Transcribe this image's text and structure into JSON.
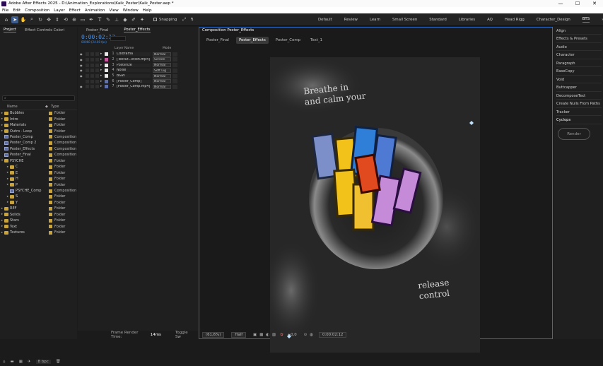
{
  "window": {
    "title": "Adobe After Effects 2025 - D:\\Animation_Explorations\\Kaik_Poster\\Kaik_Poster.aep *",
    "controls": [
      "—",
      "☐",
      "✕"
    ]
  },
  "menu": [
    "File",
    "Edit",
    "Composition",
    "Layer",
    "Effect",
    "Animation",
    "View",
    "Window",
    "Help"
  ],
  "toolbar": {
    "snapping_label": "Snapping"
  },
  "workspaces": [
    "Default",
    "Review",
    "Learn",
    "Small Screen",
    "Standard",
    "Libraries",
    "AQ",
    "Head Rigg",
    "Character_Design",
    "BTS"
  ],
  "active_workspace": "BTS",
  "project_panel": {
    "tabs": [
      "Project",
      "Effect Controls Colori"
    ],
    "search_placeholder": "",
    "columns": {
      "name": "Name",
      "type": "Type"
    },
    "items": [
      {
        "name": "Bubbles",
        "type": "Folder",
        "kind": "folder",
        "indent": 0,
        "expanded": false,
        "label_color": "#c9a43d"
      },
      {
        "name": "Intro",
        "type": "Folder",
        "kind": "folder",
        "indent": 0,
        "expanded": false,
        "label_color": "#c9a43d"
      },
      {
        "name": "Materials",
        "type": "Folder",
        "kind": "folder",
        "indent": 0,
        "expanded": false,
        "label_color": "#c9a43d"
      },
      {
        "name": "Outro - Loop",
        "type": "Folder",
        "kind": "folder",
        "indent": 0,
        "expanded": false,
        "label_color": "#c9a43d"
      },
      {
        "name": "Poster_Comp",
        "type": "Composition",
        "kind": "comp",
        "indent": 0,
        "expanded": false,
        "label_color": "#c9a43d"
      },
      {
        "name": "Poster_Comp 2",
        "type": "Composition",
        "kind": "comp",
        "indent": 0,
        "expanded": false,
        "label_color": "#c9a43d"
      },
      {
        "name": "Poster_Effects",
        "type": "Composition",
        "kind": "comp",
        "indent": 0,
        "expanded": false,
        "label_color": "#c9a43d"
      },
      {
        "name": "Poster_Final",
        "type": "Composition",
        "kind": "comp",
        "indent": 0,
        "expanded": false,
        "label_color": "#c9a43d"
      },
      {
        "name": "PSYCHE",
        "type": "Folder",
        "kind": "folder",
        "indent": 0,
        "expanded": true,
        "label_color": "#c9a43d"
      },
      {
        "name": "C",
        "type": "Folder",
        "kind": "folder",
        "indent": 1,
        "expanded": false,
        "label_color": "#c9a43d"
      },
      {
        "name": "E",
        "type": "Folder",
        "kind": "folder",
        "indent": 1,
        "expanded": false,
        "label_color": "#c9a43d"
      },
      {
        "name": "H",
        "type": "Folder",
        "kind": "folder",
        "indent": 1,
        "expanded": false,
        "label_color": "#c9a43d"
      },
      {
        "name": "P",
        "type": "Folder",
        "kind": "folder",
        "indent": 1,
        "expanded": false,
        "label_color": "#c9a43d"
      },
      {
        "name": "PSYCHE_Comp",
        "type": "Composition",
        "kind": "comp",
        "indent": 1,
        "expanded": false,
        "label_color": "#c9a43d"
      },
      {
        "name": "S",
        "type": "Folder",
        "kind": "folder",
        "indent": 1,
        "expanded": false,
        "label_color": "#c9a43d"
      },
      {
        "name": "Y",
        "type": "Folder",
        "kind": "folder",
        "indent": 1,
        "expanded": false,
        "label_color": "#c9a43d"
      },
      {
        "name": "REF",
        "type": "Folder",
        "kind": "folder",
        "indent": 0,
        "expanded": false,
        "label_color": "#c9a43d"
      },
      {
        "name": "Solids",
        "type": "Folder",
        "kind": "folder",
        "indent": 0,
        "expanded": false,
        "label_color": "#c9a43d"
      },
      {
        "name": "Stars",
        "type": "Folder",
        "kind": "folder",
        "indent": 0,
        "expanded": false,
        "label_color": "#c9a43d"
      },
      {
        "name": "Text",
        "type": "Folder",
        "kind": "folder",
        "indent": 0,
        "expanded": false,
        "label_color": "#c9a43d"
      },
      {
        "name": "Textures",
        "type": "Folder",
        "kind": "folder",
        "indent": 0,
        "expanded": false,
        "label_color": "#c9a43d"
      }
    ],
    "bpc": "8 bpc"
  },
  "timeline": {
    "tabs": [
      "Poster_Final",
      "Poster_Effects"
    ],
    "active_tab": "Poster_Effects",
    "timecode": "0:00:02:12",
    "timecode_sub": "00060 (24.00 fps)",
    "col_layer_name": "Layer Name",
    "col_mode": "Mode",
    "layers": [
      {
        "num": "1",
        "name": "Colorama",
        "mode": "Normal",
        "color": "#e8e8e8"
      },
      {
        "name": "[Textur...otion.mp4]",
        "num": "2",
        "mode": "Screen",
        "color": "#c45a9c"
      },
      {
        "num": "3",
        "name": "Posterize",
        "mode": "Normal",
        "color": "#e8e8e8"
      },
      {
        "num": "4",
        "name": "Noise",
        "mode": "Soft Lig",
        "color": "#e8e8e8"
      },
      {
        "num": "5",
        "name": "B&W",
        "mode": "Normal",
        "color": "#e8e8e8"
      },
      {
        "num": "6",
        "name": "[Poster_Comp]",
        "mode": "Normal",
        "color": "#5f6fa8"
      },
      {
        "num": "7",
        "name": "[Poster_Comp.mp4]",
        "mode": "Normal",
        "color": "#5f6fa8"
      }
    ],
    "frame_render_label": "Frame Render Time:",
    "frame_render_value": "14ms",
    "toggle_label": "Toggle Sw"
  },
  "viewer": {
    "header": "Composition Poster_Effects",
    "tabs": [
      "Poster_Final",
      "Poster_Effects",
      "Poster_Comp",
      "Text_1"
    ],
    "active_tab": "Poster_Effects",
    "poster_text_top": [
      "Breathe in",
      "and calm your"
    ],
    "poster_text_bottom": [
      "release",
      "control"
    ],
    "zoom": "(61,6%)",
    "resolution": "Half",
    "exposure": "+0,0",
    "timecode": "0:00:02:12"
  },
  "right_panel": {
    "items": [
      "Align",
      "Effects & Presets",
      "Audio",
      "Character",
      "Paragraph",
      "EaseCopy",
      "Void",
      "Buttcapper",
      "DecomposeText",
      "Create Nulls From Paths",
      "Tracker",
      "Cyclops"
    ],
    "render_label": "Render"
  }
}
